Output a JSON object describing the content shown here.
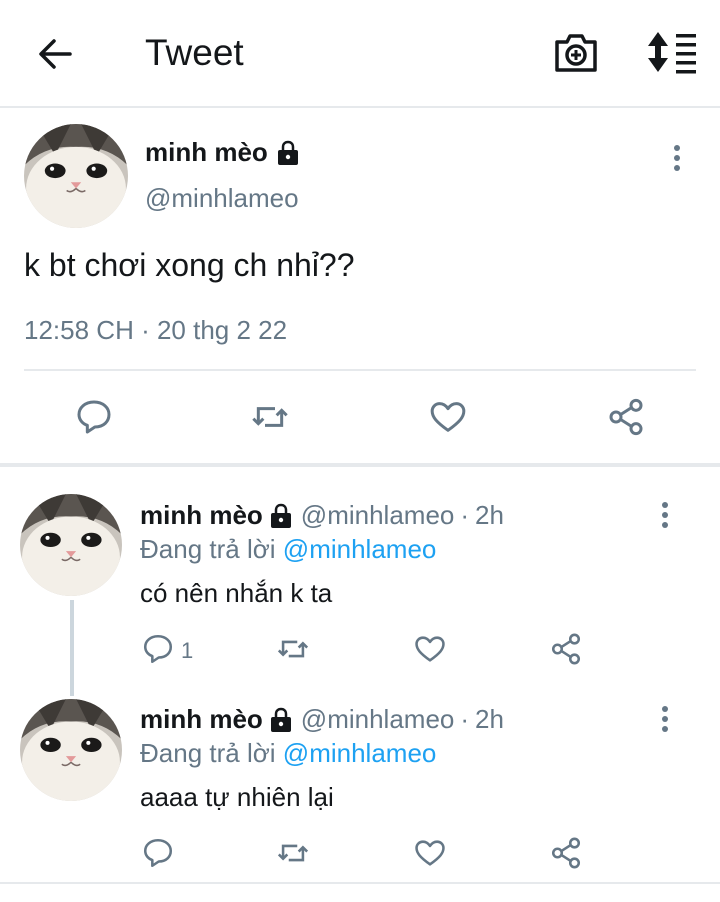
{
  "header": {
    "title": "Tweet",
    "icons": [
      "arrow-left-icon",
      "camera-icon",
      "sort-icon"
    ]
  },
  "main_tweet": {
    "display_name": "minh mèo",
    "handle": "@minhlameo",
    "text": "k bt chơi xong ch nhỉ??",
    "timestamp": "12:58 CH · 20 thg 2 22",
    "actions": [
      "reply-icon",
      "retweet-icon",
      "like-icon",
      "share-icon"
    ]
  },
  "replies": [
    {
      "display_name": "minh mèo",
      "handle": "@minhlameo",
      "separator": "·",
      "time": "2h",
      "replying_prefix": "Đang trả lời",
      "replying_to": "@minhlameo",
      "text": "có nên nhắn k ta",
      "reply_count": "1"
    },
    {
      "display_name": "minh mèo",
      "handle": "@minhlameo",
      "separator": "·",
      "time": "2h",
      "replying_prefix": "Đang trả lời",
      "replying_to": "@minhlameo",
      "text": "aaaa tự nhiên lại",
      "reply_count": ""
    }
  ],
  "colors": {
    "text": "#14171a",
    "secondary": "#657786",
    "accent": "#1da1f2",
    "divider": "#e6e9ec"
  }
}
